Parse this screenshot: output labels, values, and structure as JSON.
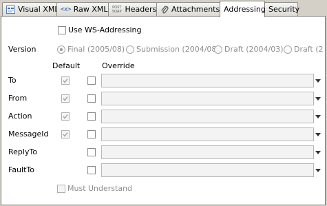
{
  "tabs": [
    {
      "label": "Visual XML",
      "icon": "visual-xml-icon"
    },
    {
      "label": "Raw XML",
      "icon": "raw-xml-icon",
      "icon_text": "<x>"
    },
    {
      "label": "Headers",
      "icon": "post-soap-icon",
      "icon_text_1": "POST",
      "icon_text_2": "SOAP"
    },
    {
      "label": "Attachments",
      "icon": "paperclip-icon"
    },
    {
      "label": "Addressing",
      "icon": ""
    },
    {
      "label": "Security",
      "icon": ""
    }
  ],
  "active_tab": "Addressing",
  "addressing": {
    "use_ws_addressing_label": "Use WS-Addressing",
    "use_ws_addressing_checked": false,
    "version_label": "Version",
    "version_options": [
      "Final (2005/08)",
      "Submission (2004/08)",
      "Draft (2004/03)",
      "Draft (2"
    ],
    "version_selected": "Final (2005/08)",
    "default_header": "Default",
    "override_header": "Override",
    "fields": [
      {
        "label": "To",
        "default_checked": true,
        "has_default": true,
        "override_checked": false,
        "value": ""
      },
      {
        "label": "From",
        "default_checked": true,
        "has_default": true,
        "override_checked": false,
        "value": ""
      },
      {
        "label": "Action",
        "default_checked": true,
        "has_default": true,
        "override_checked": false,
        "value": ""
      },
      {
        "label": "MessageId",
        "default_checked": true,
        "has_default": true,
        "override_checked": false,
        "value": ""
      },
      {
        "label": "ReplyTo",
        "default_checked": false,
        "has_default": false,
        "override_checked": false,
        "value": ""
      },
      {
        "label": "FaultTo",
        "default_checked": false,
        "has_default": false,
        "override_checked": false,
        "value": ""
      }
    ],
    "must_understand_label": "Must Understand",
    "must_understand_checked": false
  }
}
